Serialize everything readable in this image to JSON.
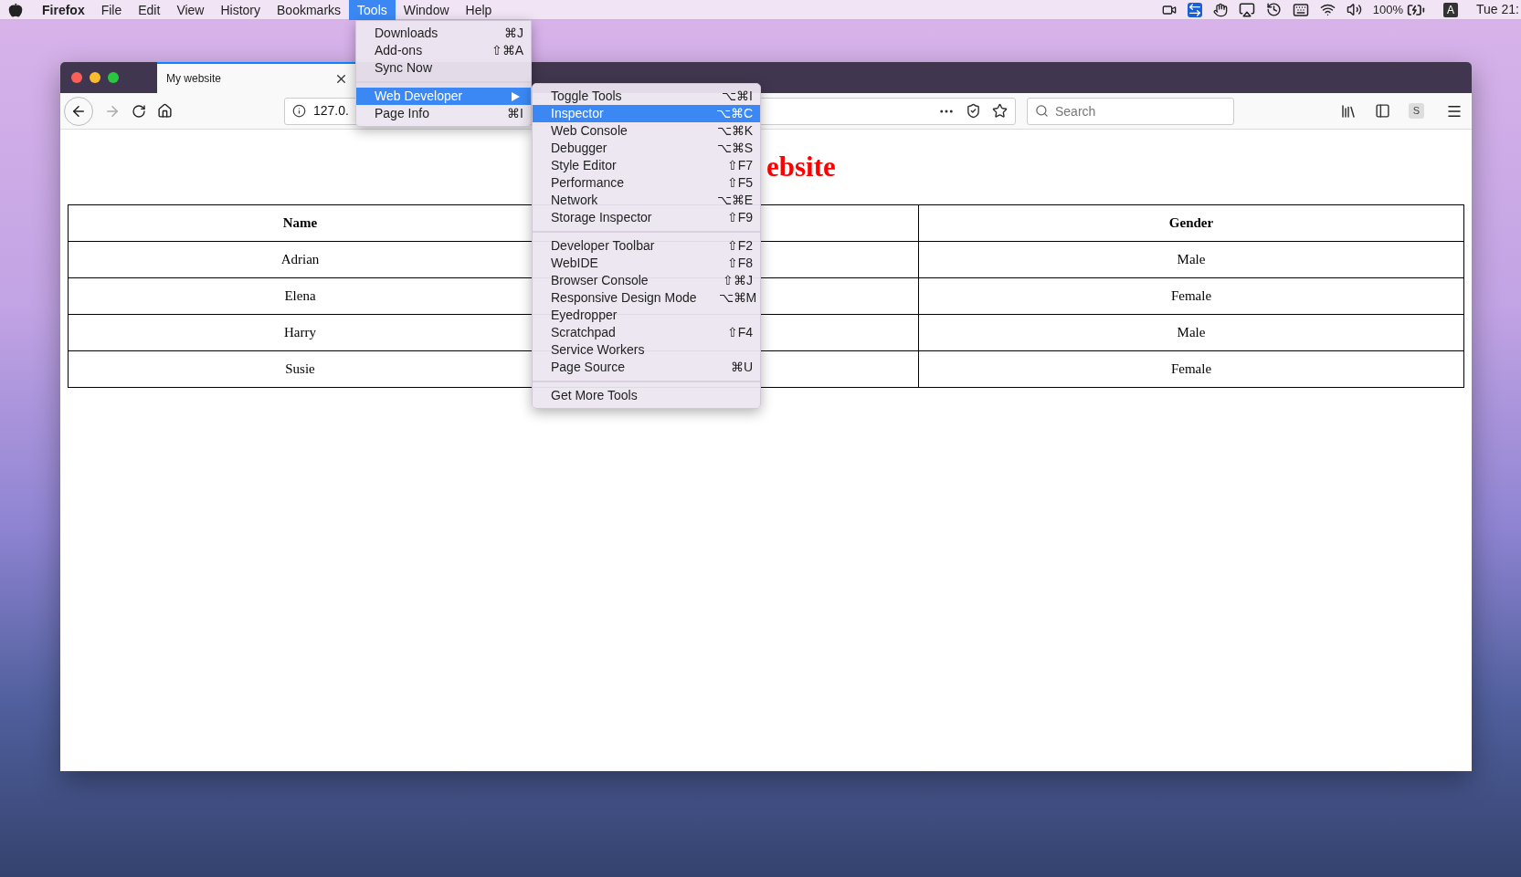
{
  "menubar": {
    "app_name": "Firefox",
    "items": [
      {
        "label": "File",
        "selected": false
      },
      {
        "label": "Edit",
        "selected": false
      },
      {
        "label": "View",
        "selected": false
      },
      {
        "label": "History",
        "selected": false
      },
      {
        "label": "Bookmarks",
        "selected": false
      },
      {
        "label": "Tools",
        "selected": true
      },
      {
        "label": "Window",
        "selected": false
      },
      {
        "label": "Help",
        "selected": false
      }
    ],
    "battery_percent": "100%",
    "input_source": "A",
    "clock": "Tue 21:"
  },
  "browser": {
    "tab_title": "My website",
    "extension_badge": "S",
    "url": "127.0.",
    "search": {
      "placeholder": "Search"
    }
  },
  "page": {
    "heading": "ebsite",
    "table": {
      "columns": [
        "Name",
        "Gender"
      ],
      "rows": [
        {
          "name": "Adrian",
          "gender": "Male"
        },
        {
          "name": "Elena",
          "gender": "Female"
        },
        {
          "name": "Harry",
          "gender": "Male"
        },
        {
          "name": "Susie",
          "gender": "Female"
        }
      ]
    }
  },
  "tools_menu": {
    "groups": [
      [
        {
          "label": "Downloads",
          "shortcut": "⌘J",
          "selected": false,
          "submenu": false
        },
        {
          "label": "Add-ons",
          "shortcut": "⇧⌘A",
          "selected": false,
          "submenu": false
        },
        {
          "label": "Sync Now",
          "selected": false,
          "submenu": false
        }
      ],
      [
        {
          "label": "Web Developer",
          "selected": true,
          "submenu": true
        },
        {
          "label": "Page Info",
          "shortcut": "⌘I",
          "selected": false,
          "submenu": false
        }
      ]
    ]
  },
  "web_developer_menu": {
    "groups": [
      [
        {
          "label": "Toggle Tools",
          "shortcut": "⌥⌘I",
          "selected": false
        },
        {
          "label": "Inspector",
          "shortcut": "⌥⌘C",
          "selected": true
        },
        {
          "label": "Web Console",
          "shortcut": "⌥⌘K",
          "selected": false
        },
        {
          "label": "Debugger",
          "shortcut": "⌥⌘S",
          "selected": false
        },
        {
          "label": "Style Editor",
          "shortcut": "⇧F7",
          "selected": false
        },
        {
          "label": "Performance",
          "shortcut": "⇧F5",
          "selected": false
        },
        {
          "label": "Network",
          "shortcut": "⌥⌘E",
          "selected": false
        },
        {
          "label": "Storage Inspector",
          "shortcut": "⇧F9",
          "selected": false
        }
      ],
      [
        {
          "label": "Developer Toolbar",
          "shortcut": "⇧F2",
          "selected": false
        },
        {
          "label": "WebIDE",
          "shortcut": "⇧F8",
          "selected": false
        },
        {
          "label": "Browser Console",
          "shortcut": "⇧⌘J",
          "selected": false
        },
        {
          "label": "Responsive Design Mode",
          "shortcut": "⌥⌘M",
          "selected": false
        },
        {
          "label": "Eyedropper",
          "selected": false
        },
        {
          "label": "Scratchpad",
          "shortcut": "⇧F4",
          "selected": false
        },
        {
          "label": "Service Workers",
          "selected": false
        },
        {
          "label": "Page Source",
          "shortcut": "⌘U",
          "selected": false
        }
      ],
      [
        {
          "label": "Get More Tools",
          "selected": false
        }
      ]
    ]
  }
}
